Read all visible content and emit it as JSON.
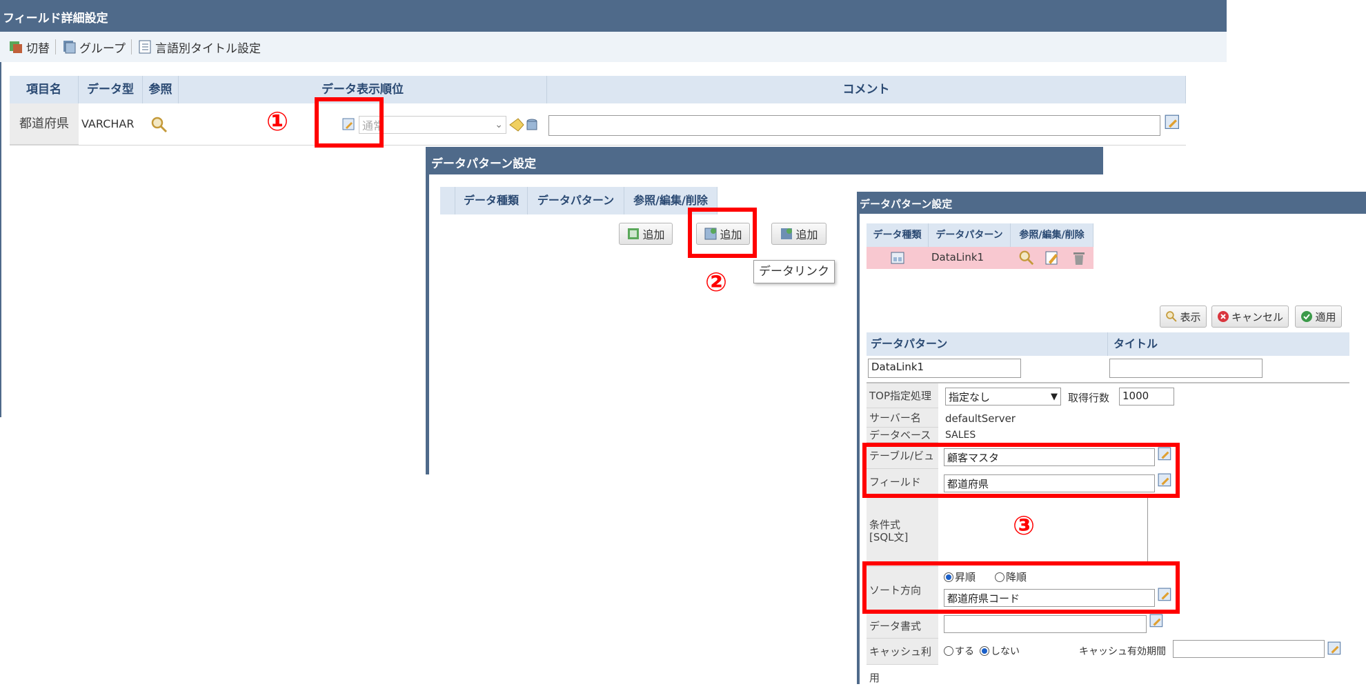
{
  "main": {
    "title": "フィールド詳細設定",
    "toolbar": {
      "switch": "切替",
      "group": "グループ",
      "lang_title": "言語別タイトル設定"
    },
    "headers": [
      "項目名",
      "データ型",
      "参照",
      "データ表示順位",
      "コメント"
    ],
    "row": {
      "name": "都道府県",
      "type": "VARCHAR",
      "order_value": "通常",
      "comment": ""
    }
  },
  "dlg1": {
    "title": "データパターン設定",
    "headers": [
      "データ種類",
      "データパターン",
      "参照/編集/削除"
    ],
    "add_label": "追加",
    "tooltip": "データリンク"
  },
  "dlg2": {
    "title": "データパターン設定",
    "headers": [
      "データ種類",
      "データパターン",
      "参照/編集/削除"
    ],
    "row_pattern": "DataLink1",
    "buttons": {
      "view": "表示",
      "cancel": "キャンセル",
      "apply": "適用"
    },
    "form_headers": {
      "pattern": "データパターン",
      "title": "タイトル"
    },
    "pattern_value": "DataLink1",
    "title_value": "",
    "top_label": "TOP指定処理",
    "top_value": "指定なし",
    "rows_label": "取得行数",
    "rows_value": "1000",
    "server_label": "サーバー名",
    "server_value": "defaultServer",
    "db_label": "データベース",
    "db_value": "SALES",
    "table_label": "テーブル/ビュー",
    "table_value": "顧客マスタ",
    "field_label": "フィールド",
    "field_value": "都道府県",
    "cond_label_1": "条件式",
    "cond_label_2": "[SQL文]",
    "sort_label": "ソート方向",
    "sort_asc": "昇順",
    "sort_desc": "降順",
    "sort_value": "都道府県コード",
    "format_label": "データ書式",
    "format_value": "",
    "cache_label": "キャッシュ利用",
    "cache_yes": "する",
    "cache_no": "しない",
    "cache_period_label": "キャッシュ有効期間",
    "cache_period_value": ""
  },
  "annotations": {
    "one": "①",
    "two": "②",
    "three": "③"
  },
  "colors": {
    "titlebar": "#4f6a8a",
    "header_bg": "#dce6f2",
    "highlight": "#ff0000",
    "selected_row": "#f8c8d0"
  }
}
